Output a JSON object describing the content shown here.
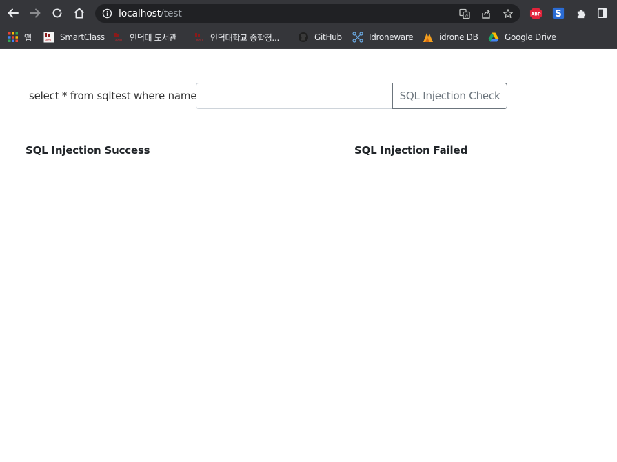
{
  "browser": {
    "url_host": "localhost",
    "url_path": "/test",
    "nav": {
      "back_icon": "back-arrow-icon",
      "forward_icon": "forward-arrow-icon",
      "reload_icon": "reload-icon",
      "home_icon": "home-icon"
    },
    "extensions": [
      {
        "name": "adblock-plus-icon",
        "text": "ABP"
      },
      {
        "name": "s-extension-icon",
        "text": "S"
      },
      {
        "name": "puzzle-extensions-icon",
        "text": ""
      },
      {
        "name": "side-panel-icon",
        "text": ""
      }
    ],
    "bookmarks": [
      {
        "label": "앱",
        "icon": "apps-grid-icon"
      },
      {
        "label": "SmartClass",
        "icon": "inha-edu-icon"
      },
      {
        "label": "인덕대 도서관",
        "icon": "inha-edu-icon"
      },
      {
        "label": "인덕대학교 종합정...",
        "icon": "inha-edu-icon"
      },
      {
        "label": "GitHub",
        "icon": "github-icon"
      },
      {
        "label": "Idroneware",
        "icon": "drone-icon"
      },
      {
        "label": "idrone DB",
        "icon": "idrone-db-icon"
      },
      {
        "label": "Google Drive",
        "icon": "google-drive-icon"
      }
    ],
    "colors": {
      "chrome_bg": "#35363a",
      "omnibox_bg": "#202124"
    }
  },
  "page": {
    "query_label": "select * from sqltest where name",
    "query_input_value": "",
    "check_button_label": "SQL Injection Check",
    "success_heading": "SQL Injection Success",
    "failed_heading": "SQL Injection Failed"
  }
}
